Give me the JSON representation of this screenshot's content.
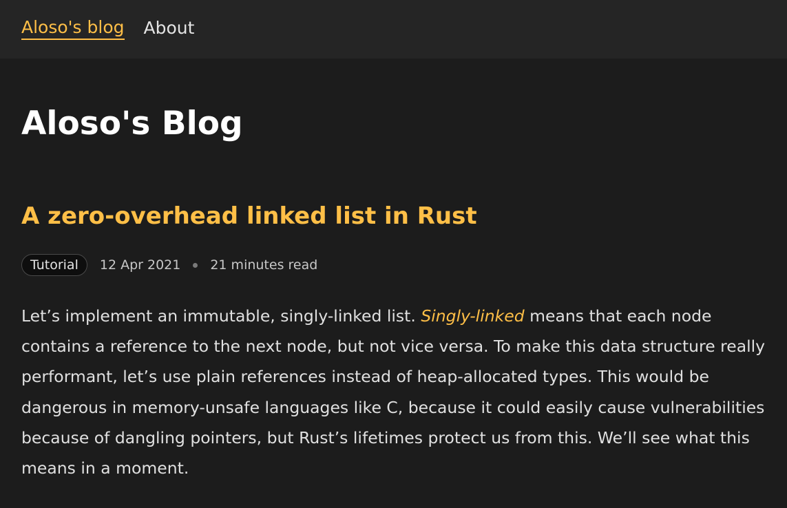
{
  "nav": {
    "brand": "Aloso's blog",
    "about": "About"
  },
  "page": {
    "title": "Aloso's Blog"
  },
  "post": {
    "title": "A zero-overhead linked list in Rust",
    "tag": "Tutorial",
    "date": "12 Apr 2021",
    "read_time": "21 minutes read",
    "intro_before": "Let’s implement an immutable, singly-linked list.",
    "intro_emphasis": "Singly-linked",
    "intro_after": "means that each node contains a reference to the next node, but not vice versa. To make this data structure really performant, let’s use plain references instead of heap-allocated types. This would be dangerous in memory-unsafe languages like C, because it could easily cause vulnerabilities because of dangling pointers, but Rust’s lifetimes protect us from this. We’ll see what this means in a moment."
  },
  "colors": {
    "accent": "#ffbf47",
    "background": "#1c1c1c",
    "nav_background": "#252525"
  }
}
